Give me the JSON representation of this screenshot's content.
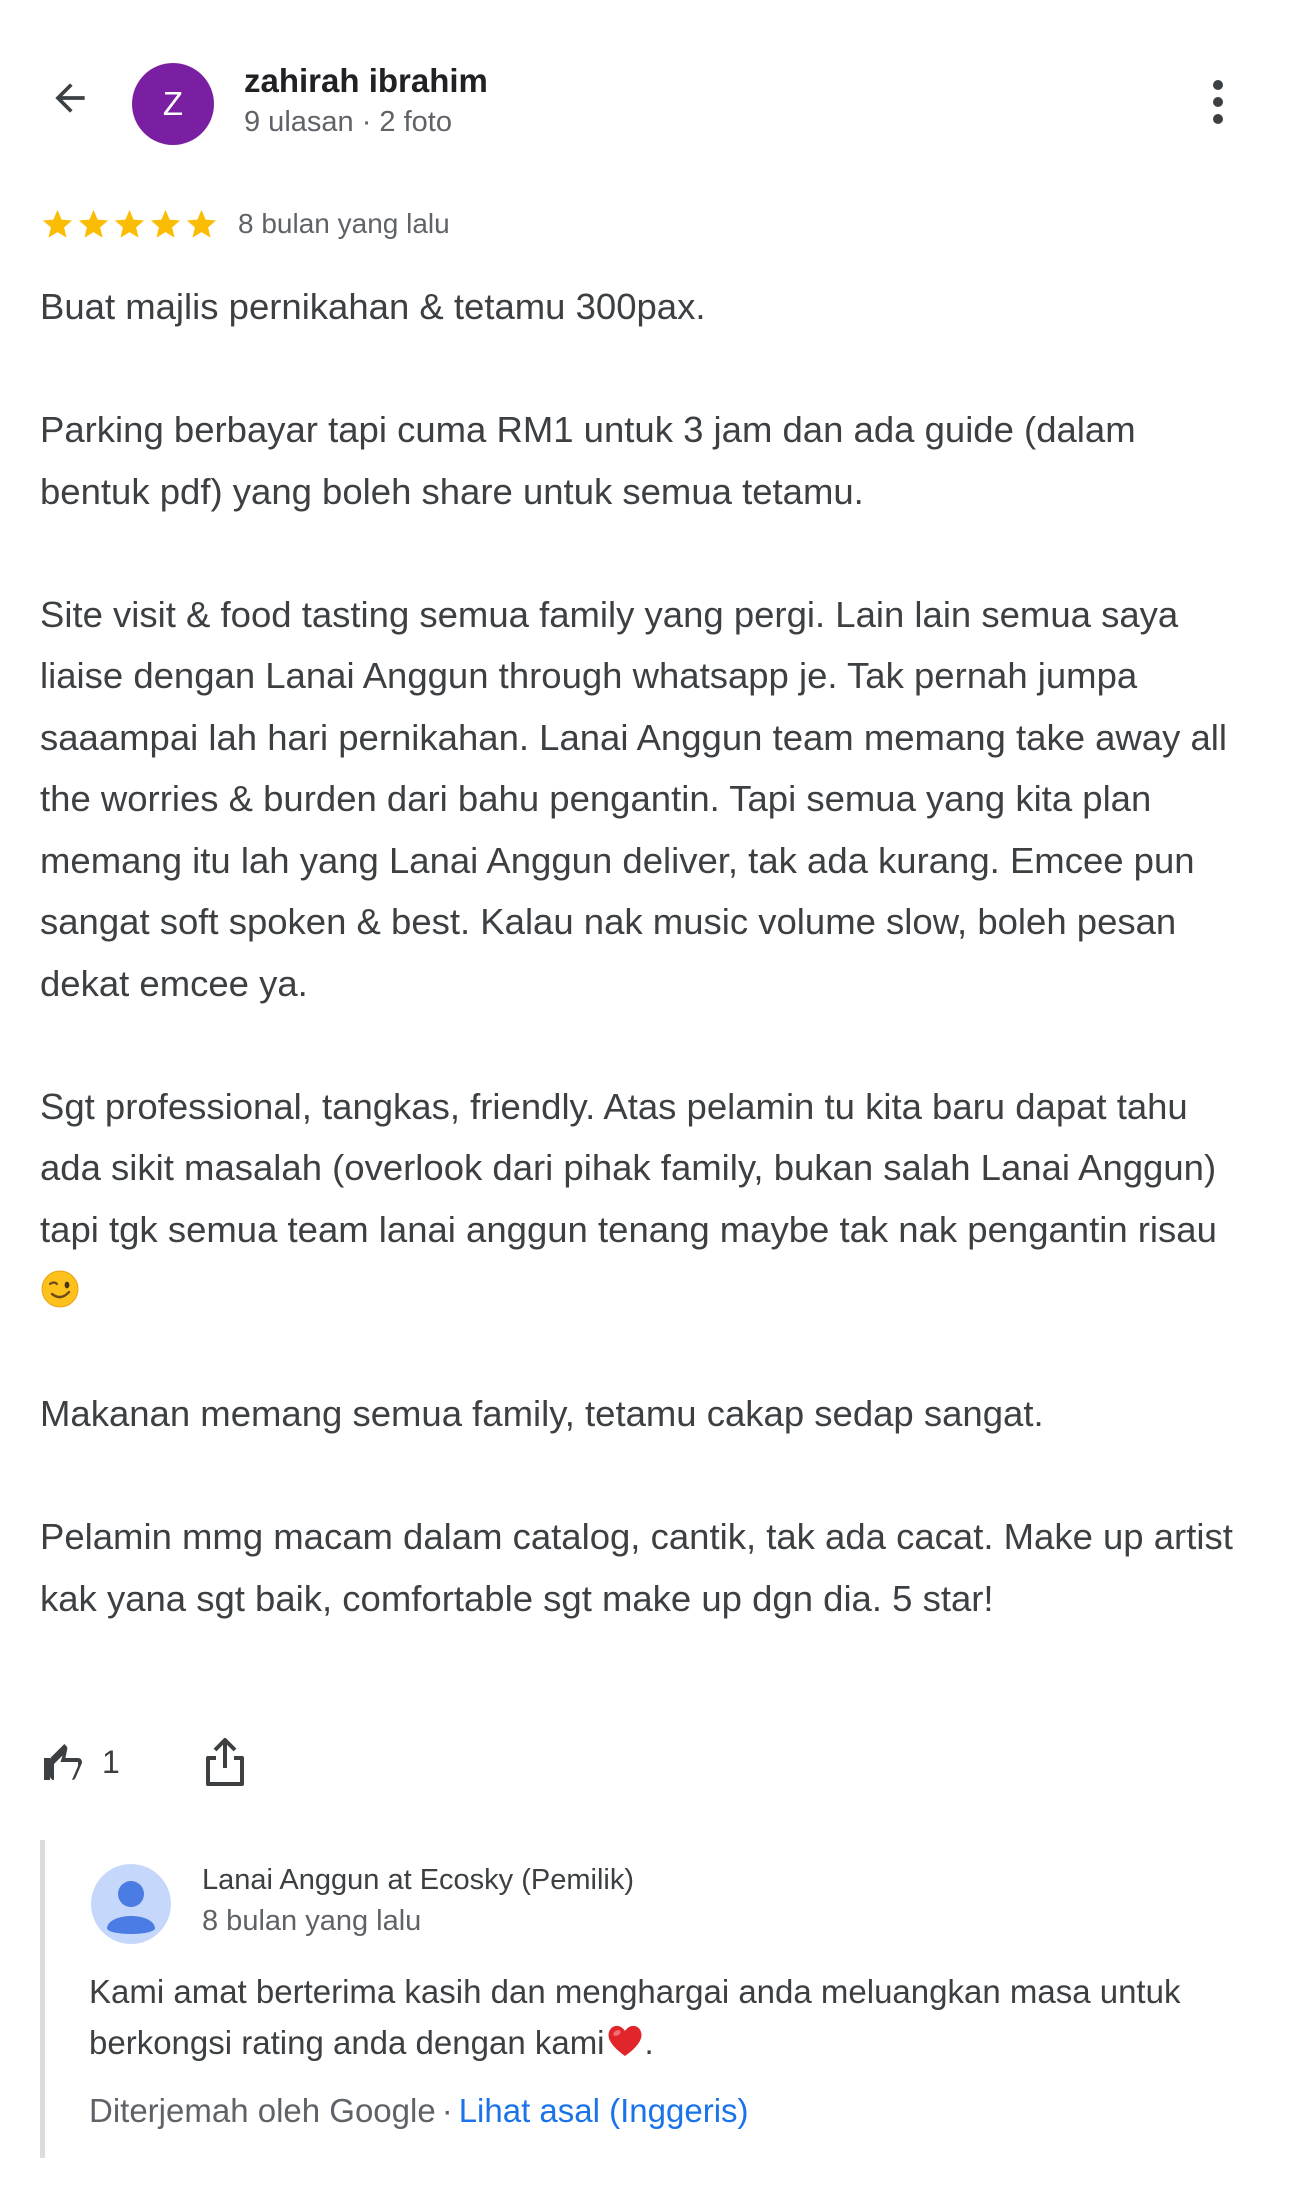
{
  "header": {
    "avatar_letter": "Z",
    "author_name": "zahirah ibrahim",
    "author_meta": "9 ulasan · 2 foto",
    "avatar_color": "#7b1fa2",
    "back_icon": "arrow-back-icon",
    "more_icon": "more-vert-icon"
  },
  "review": {
    "rating": 5,
    "star_color": "#fbbc04",
    "date": "8 bulan yang lalu",
    "paragraphs": [
      "Buat majlis pernikahan & tetamu 300pax.",
      "Parking berbayar tapi cuma RM1 untuk 3 jam dan ada guide (dalam bentuk pdf) yang boleh share untuk semua tetamu.",
      "Site visit & food tasting semua family yang pergi. Lain lain semua saya liaise dengan Lanai Anggun through whatsapp je. Tak pernah jumpa saaampai lah hari pernikahan. Lanai Anggun team memang take away all the worries & burden dari bahu pengantin. Tapi semua yang kita plan memang itu lah yang Lanai Anggun deliver, tak ada kurang. Emcee pun sangat soft spoken & best. Kalau nak music volume slow, boleh pesan dekat emcee ya.",
      "Sgt professional, tangkas, friendly. Atas pelamin tu kita baru dapat tahu ada sikit masalah (overlook dari pihak family, bukan salah Lanai Anggun) tapi tgk semua team lanai anggun tenang maybe tak nak pengantin risau",
      "Makanan memang semua family, tetamu cakap sedap sangat.",
      "Pelamin mmg macam dalam catalog, cantik, tak ada cacat. Make up artist kak yana sgt baik, comfortable sgt make up dgn dia. 5 star!"
    ],
    "emoji_icon": "winking-face-icon"
  },
  "actions": {
    "like_count": "1",
    "like_icon": "thumb-up-icon",
    "share_icon": "share-icon"
  },
  "owner_reply": {
    "name": "Lanai Anggun at Ecosky (Pemilik)",
    "date": "8 bulan yang lalu",
    "text": "Kami amat berterima kasih dan menghargai anda meluangkan masa untuk berkongsi rating anda dengan kami",
    "text_end": ".",
    "heart_icon": "red-heart-icon",
    "translated_by": "Diterjemah oleh Google",
    "separator": "·",
    "view_original": "Lihat asal (Inggeris)",
    "link_color": "#1a73e8"
  }
}
